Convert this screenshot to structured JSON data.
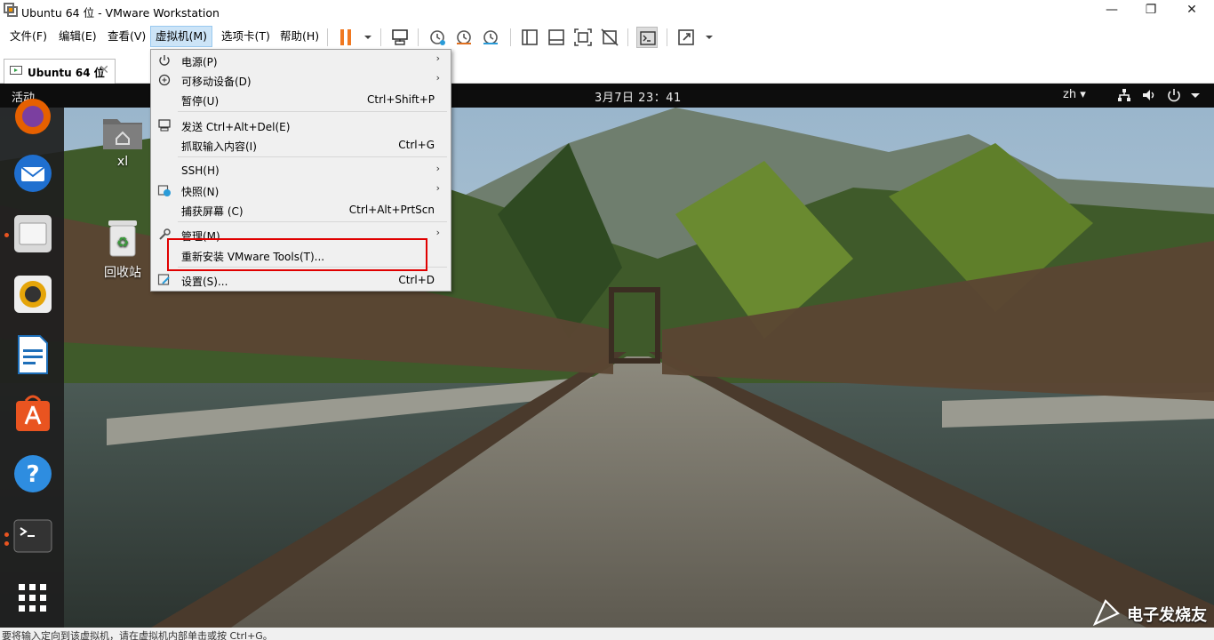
{
  "window": {
    "title": "Ubuntu 64 位 - VMware Workstation",
    "minimize": "—",
    "maximize": "❐",
    "close": "✕"
  },
  "menubar": {
    "items": [
      {
        "label": "文件(F)"
      },
      {
        "label": "编辑(E)"
      },
      {
        "label": "查看(V)"
      },
      {
        "label": "虚拟机(M)",
        "active": true
      },
      {
        "label": "选项卡(T)"
      },
      {
        "label": "帮助(H)"
      }
    ]
  },
  "toolbar": {
    "icons": [
      "pause-icon",
      "send-ctrl-alt-del-icon",
      "snapshot-icon",
      "revert-snapshot-icon",
      "snapshot-manager-icon",
      "show-library-icon",
      "thumbnail-bar-icon",
      "full-screen-icon",
      "unity-icon",
      "console-view-icon",
      "stretch-guest-icon"
    ]
  },
  "tab": {
    "label": "Ubuntu 64 位",
    "close": "✕"
  },
  "guest": {
    "activities": "活动",
    "clock": "3月7日  23：41",
    "lang": "zh ▾",
    "dock": [
      "firefox-icon",
      "thunderbird-icon",
      "files-icon",
      "rhythmbox-icon",
      "libreoffice-writer-icon",
      "ubuntu-software-icon",
      "help-icon",
      "terminal-icon",
      "show-applications-icon"
    ],
    "desktop_icons": [
      {
        "label": "xl",
        "icon": "home-folder-icon"
      },
      {
        "label": "回收站",
        "icon": "trash-icon"
      }
    ]
  },
  "vm_menu": {
    "items": [
      {
        "label": "电源(P)",
        "shortcut": "",
        "submenu": true,
        "icon": "power-icon"
      },
      {
        "label": "可移动设备(D)",
        "shortcut": "",
        "submenu": true,
        "icon": "removable-devices-icon"
      },
      {
        "label": "暂停(U)",
        "shortcut": "Ctrl+Shift+P",
        "submenu": false,
        "icon": ""
      },
      {
        "label": "发送 Ctrl+Alt+Del(E)",
        "shortcut": "",
        "submenu": false,
        "icon": "send-keys-icon"
      },
      {
        "label": "抓取输入内容(I)",
        "shortcut": "Ctrl+G",
        "submenu": false,
        "icon": ""
      },
      {
        "label": "SSH(H)",
        "shortcut": "",
        "submenu": true,
        "icon": ""
      },
      {
        "label": "快照(N)",
        "shortcut": "",
        "submenu": true,
        "icon": "snapshot-icon"
      },
      {
        "label": "捕获屏幕 (C)",
        "shortcut": "Ctrl+Alt+PrtScn",
        "submenu": false,
        "icon": ""
      },
      {
        "label": "管理(M)",
        "shortcut": "",
        "submenu": true,
        "icon": "wrench-icon"
      },
      {
        "label": "重新安装 VMware Tools(T)...",
        "shortcut": "",
        "submenu": false,
        "icon": ""
      },
      {
        "label": "设置(S)...",
        "shortcut": "Ctrl+D",
        "submenu": false,
        "icon": "settings-icon"
      }
    ]
  },
  "statusbar": {
    "text": "要将输入定向到该虚拟机，请在虚拟机内部单击或按 Ctrl+G。"
  },
  "watermark": "电子发烧友",
  "colors": {
    "highlight_border": "#e00000",
    "menu_bg": "#f0f0f0",
    "active_menu_bg": "#cce4f7",
    "dock_dot": "#e95420"
  }
}
